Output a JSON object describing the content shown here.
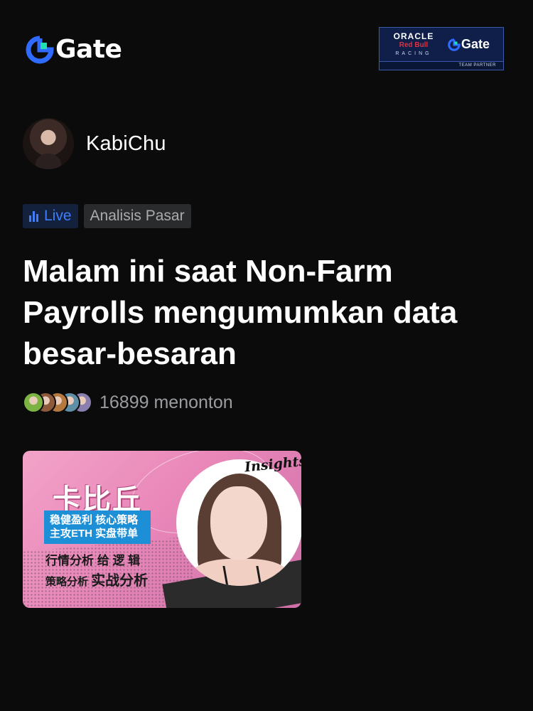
{
  "header": {
    "brand": "Gate",
    "partner": {
      "oracle": "ORACLE",
      "redbull": "Red Bull",
      "racing": "RACING",
      "brand": "Gate",
      "strip": "TEAM PARTNER"
    }
  },
  "author": {
    "name": "KabiChu"
  },
  "tags": {
    "live": "Live",
    "category": "Analisis Pasar"
  },
  "post": {
    "title": "Malam ini saat Non-Farm Payrolls mengumumkan data besar-besaran"
  },
  "viewers": {
    "count_text": "16899 menonton",
    "avatar_colors": [
      "#7cb342",
      "#8d5a3b",
      "#b5793f",
      "#5f8fa6",
      "#8b7fb0"
    ]
  },
  "thumbnail": {
    "name": "卡比丘",
    "box_line1": "稳健盈利  核心策略",
    "box_line2": "主攻ETH  实盘带单",
    "line3": "行情分析 给 逻 辑",
    "line4_a": "策略分析",
    "line4_b": "实战分析",
    "badge": "Insights"
  },
  "colors": {
    "accent": "#3f7dfa",
    "background": "#0b0b0c",
    "gate_icon_cyan": "#1ee0b0",
    "gate_icon_blue": "#2f6bff"
  }
}
